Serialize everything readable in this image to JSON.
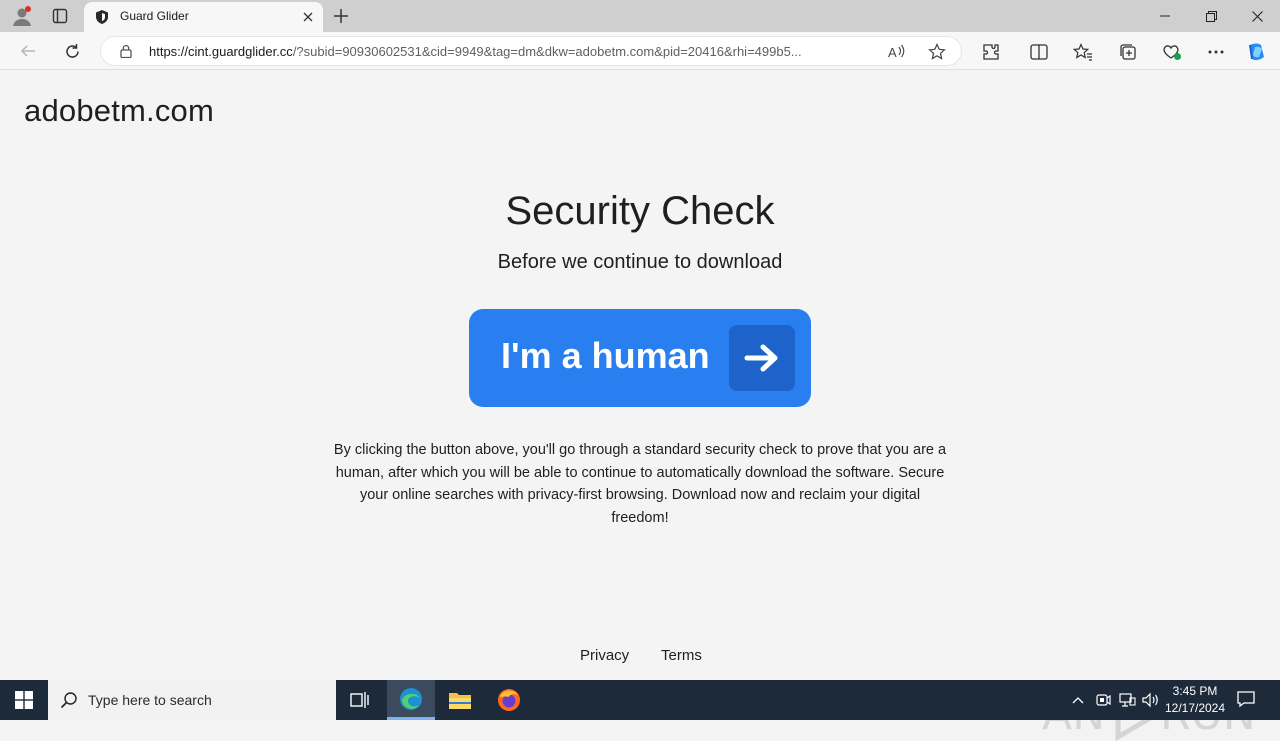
{
  "browser": {
    "tab_title": "Guard Glider",
    "url_host": "https://cint.guardglider.cc",
    "url_rest": "/?subid=90930602531&cid=9949&tag=dm&dkw=adobetm.com&pid=20416&rhi=499b5..."
  },
  "page": {
    "site_name": "adobetm.com",
    "headline": "Security Check",
    "subhead": "Before we continue to download",
    "button_label": "I'm a human",
    "description": "By clicking the button above, you'll go through a standard security check to prove that you are a human, after which you will be able to continue to automatically download the software. Secure your online searches with privacy-first browsing. Download now and reclaim your digital freedom!",
    "footer": {
      "privacy": "Privacy",
      "terms": "Terms"
    },
    "accent_color": "#2a7ff0",
    "accent_dark": "#1d63c9"
  },
  "watermark": {
    "left": "ANY",
    "right": "RUN"
  },
  "taskbar": {
    "search_placeholder": "Type here to search",
    "time": "3:45 PM",
    "date": "12/17/2024"
  }
}
